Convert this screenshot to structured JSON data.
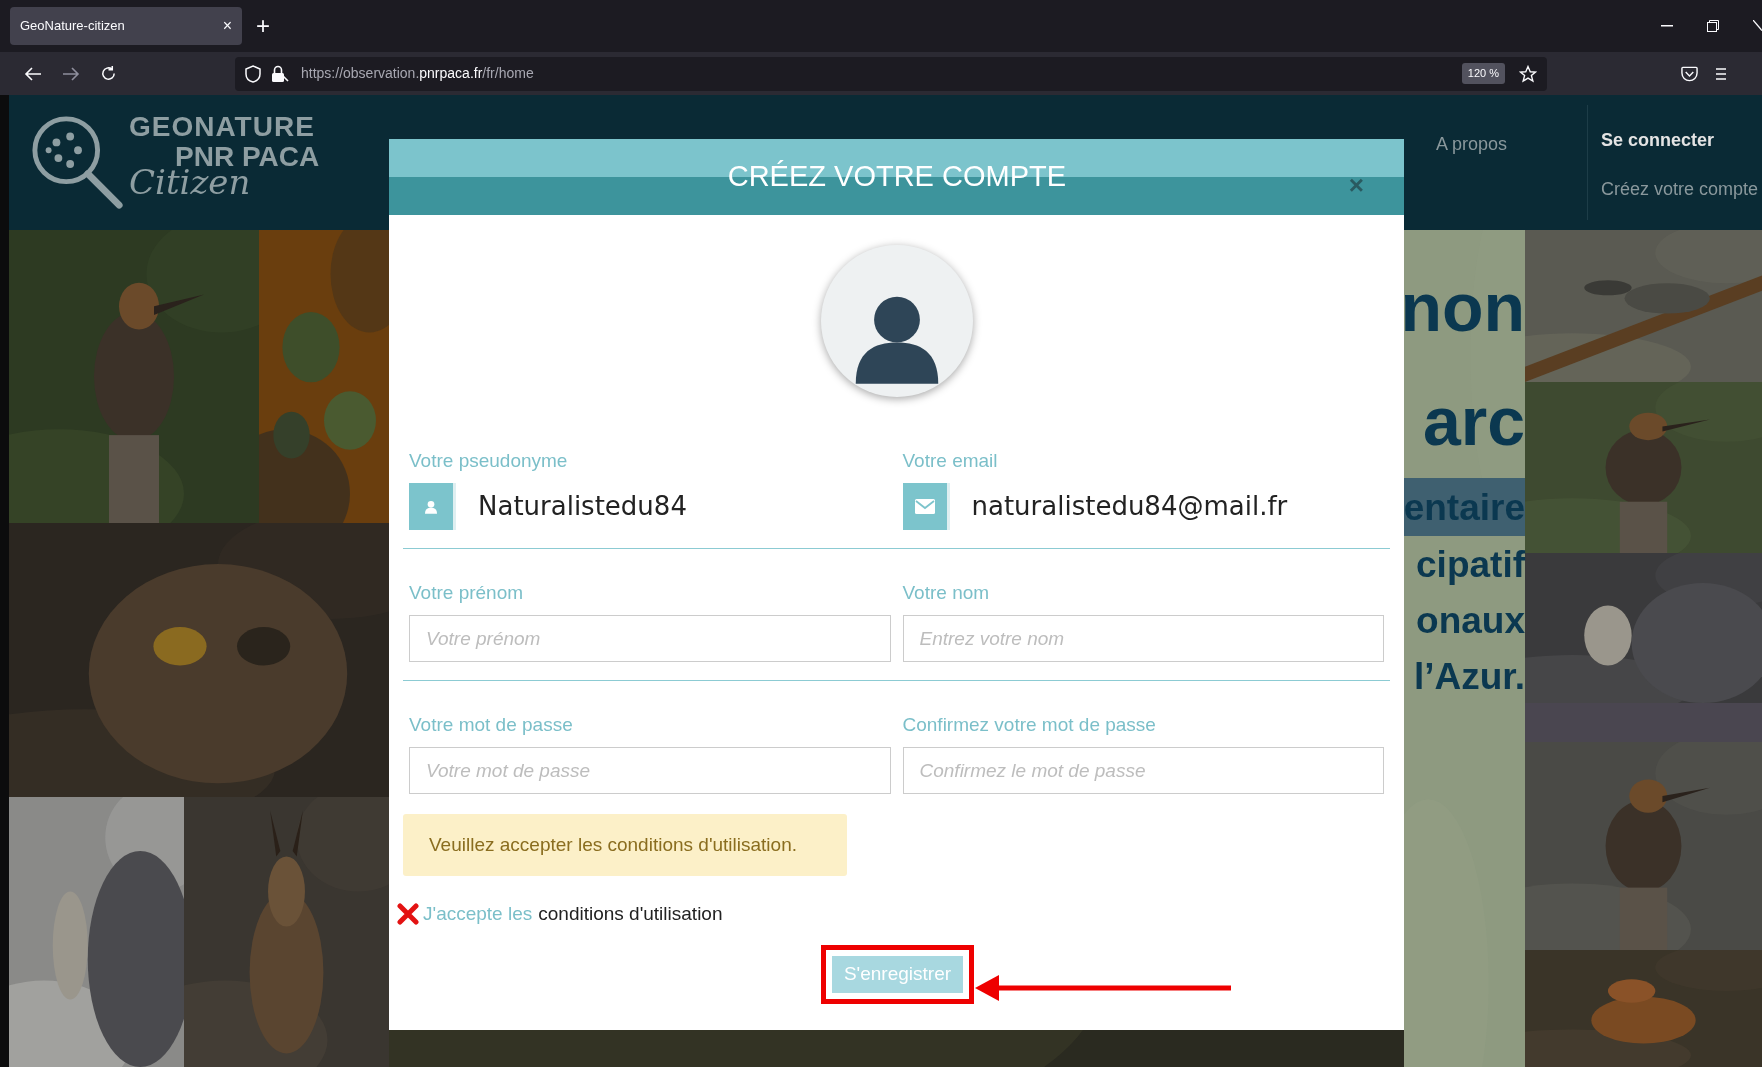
{
  "browser": {
    "tab": {
      "title": "GeoNature-citizen",
      "close": "×",
      "selected": true
    },
    "new_tab": "+",
    "url": "https://observation.**pnrpaca.fr**/fr/home",
    "zoom": "120 %"
  },
  "header": {
    "logo": {
      "line_1": "GEONATURE",
      "line_2": "PNR PACA",
      "line_3": "Citizen"
    },
    "nav": [
      {
        "label": "A propos"
      }
    ],
    "account": [
      {
        "label": "Se connecter",
        "kind": "strong"
      },
      {
        "label": "Créez votre compte",
        "kind": "plain"
      }
    ]
  },
  "hero_fragments": [
    {
      "text": "non",
      "kind": "title"
    },
    {
      "text": "arc",
      "kind": "title"
    },
    {
      "text": "entaire",
      "kind": "banner"
    },
    {
      "text": "cipatif",
      "kind": "line"
    },
    {
      "text": "onaux",
      "kind": "line"
    },
    {
      "text": "l’Azur.",
      "kind": "line"
    }
  ],
  "modal": {
    "title": "CRÉEZ VOTRE COMPTE",
    "close": "×",
    "rows": [
      [
        {
          "label": "Votre pseudonyme",
          "value": "Naturalistedu84",
          "kind": "addon"
        },
        {
          "label": "Votre email",
          "value": "naturalistedu84@mail.fr",
          "kind": "addon"
        }
      ],
      [
        {
          "label": "Votre prénom",
          "placeholder": "Votre prénom",
          "kind": "plain"
        },
        {
          "label": "Votre nom",
          "placeholder": "Entrez votre nom",
          "kind": "plain"
        }
      ],
      [
        {
          "label": "Votre mot de passe",
          "placeholder": "Votre mot de passe",
          "kind": "plain"
        },
        {
          "label": "Confirmez votre mot de passe",
          "placeholder": "Confirmez le mot de passe",
          "kind": "plain"
        }
      ]
    ],
    "alert": "Veuillez accepter les conditions d'utilisation.",
    "terms": {
      "checked": false,
      "prefix": "J'accepte les",
      "link": "conditions d'utilisation"
    },
    "submit": "S'enregistrer"
  }
}
